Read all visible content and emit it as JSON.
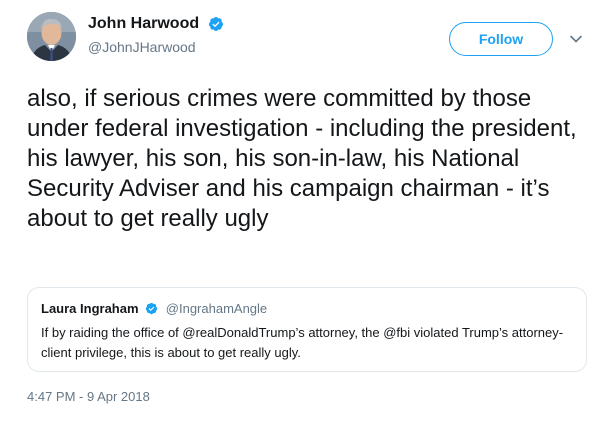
{
  "author": {
    "display_name": "John Harwood",
    "handle": "@JohnJHarwood",
    "verified": true
  },
  "follow_button": {
    "label": "Follow"
  },
  "tweet": {
    "text": "also, if serious crimes were committed by those under federal investigation - including the president, his lawyer, his son, his son-in-law, his National Security Adviser and his campaign chairman - it’s about to get really ugly",
    "timestamp": "4:47 PM - 9 Apr 2018"
  },
  "quoted_tweet": {
    "display_name": "Laura Ingraham",
    "handle": "@IngrahamAngle",
    "verified": true,
    "text": "If by raiding the office of @realDonaldTrump’s attorney, the @fbi violated Trump’s attorney-client privilege, this is about to get  really ugly."
  },
  "icons": {
    "verified": "verified-badge-icon",
    "more_menu": "chevron-down-icon"
  },
  "colors": {
    "accent": "#1da1f2",
    "text_primary": "#14171a",
    "text_secondary": "#657786",
    "border": "#e1e8ed"
  }
}
